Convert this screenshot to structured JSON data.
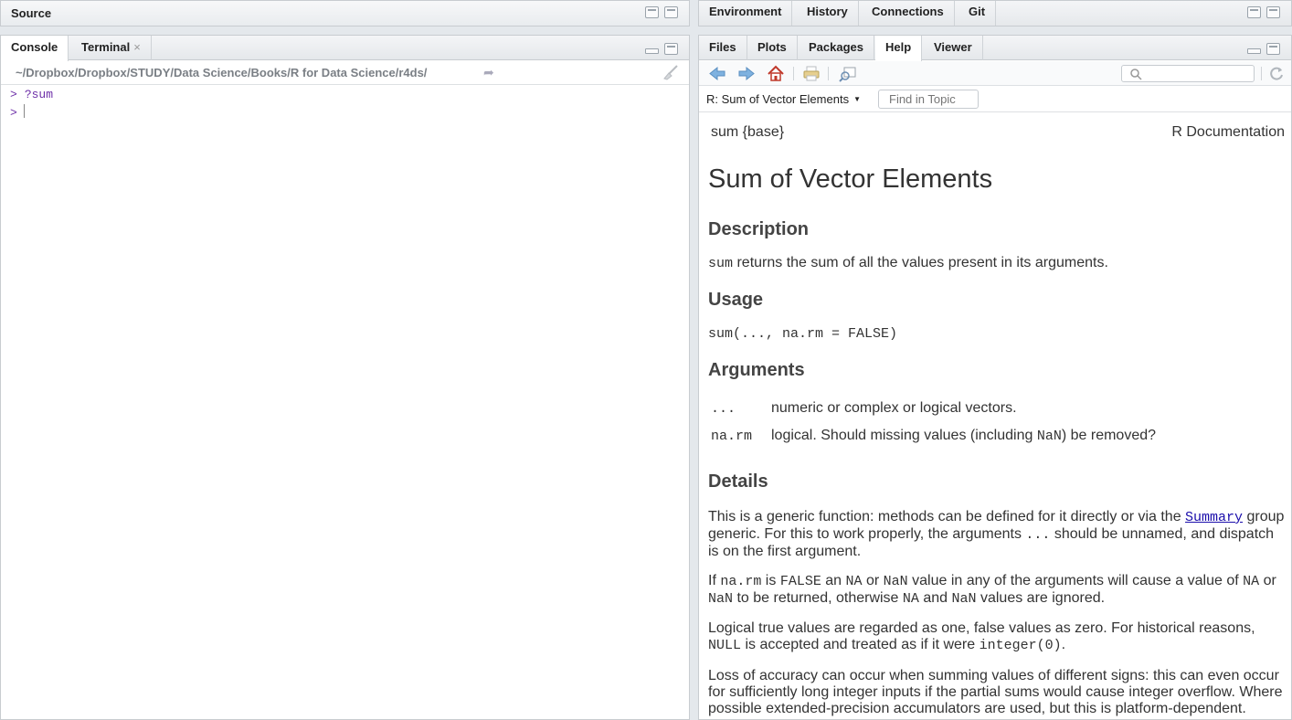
{
  "source_pane": {
    "title": "Source"
  },
  "console_pane": {
    "tabs": [
      {
        "label": "Console",
        "active": true
      },
      {
        "label": "Terminal",
        "close": "×",
        "active": false
      }
    ],
    "path": "~/Dropbox/Dropbox/STUDY/Data Science/Books/R for Data Science/r4ds/",
    "lines": [
      {
        "prompt": ">",
        "command": "?sum"
      },
      {
        "prompt": ">",
        "command": ""
      }
    ]
  },
  "env_pane": {
    "tabs": [
      "Environment",
      "History",
      "Connections",
      "Git"
    ]
  },
  "help_pane": {
    "tabs": [
      {
        "label": "Files",
        "active": false
      },
      {
        "label": "Plots",
        "active": false
      },
      {
        "label": "Packages",
        "active": false
      },
      {
        "label": "Help",
        "active": true
      },
      {
        "label": "Viewer",
        "active": false
      }
    ],
    "topic": "R: Sum of Vector Elements",
    "find_placeholder": "Find in Topic",
    "doc": {
      "package_label": "sum {base}",
      "rdoc_label": "R Documentation",
      "title": "Sum of Vector Elements",
      "description_heading": "Description",
      "description_code": "sum",
      "description_text": " returns the sum of all the values present in its arguments.",
      "usage_heading": "Usage",
      "usage_code": "sum(..., na.rm = FALSE)",
      "arguments_heading": "Arguments",
      "args": [
        {
          "name": "...",
          "desc_before": "numeric or complex or logical vectors.",
          "code": "",
          "desc_after": ""
        },
        {
          "name": "na.rm",
          "desc_before": "logical. Should missing values (including ",
          "code": "NaN",
          "desc_after": ") be removed?"
        }
      ],
      "details_heading": "Details",
      "details_p1": {
        "a": "This is a generic function: methods can be defined for it directly or via the ",
        "link": "Summary",
        "b": " group generic. For this to work properly, the arguments ",
        "code": "...",
        "c": " should be unnamed, and dispatch is on the first argument."
      },
      "details_p2": {
        "a": "If ",
        "c1": "na.rm",
        "b": " is ",
        "c2": "FALSE",
        "c": " an ",
        "c3": "NA",
        "d": " or ",
        "c4": "NaN",
        "e": " value in any of the arguments will cause a value of ",
        "c5": "NA",
        "f": " or ",
        "c6": "NaN",
        "g": " to be returned, otherwise ",
        "c7": "NA",
        "h": " and ",
        "c8": "NaN",
        "i": " values are ignored."
      },
      "details_p3": {
        "a": "Logical true values are regarded as one, false values as zero. For historical reasons, ",
        "c1": "NULL",
        "b": " is accepted and treated as if it were ",
        "c2": "integer(0)",
        "c": "."
      },
      "details_p4": "Loss of accuracy can occur when summing values of different signs: this can even occur for sufficiently long integer inputs if the partial sums would cause integer overflow. Where possible extended-precision accumulators are used, but this is platform-dependent."
    }
  }
}
